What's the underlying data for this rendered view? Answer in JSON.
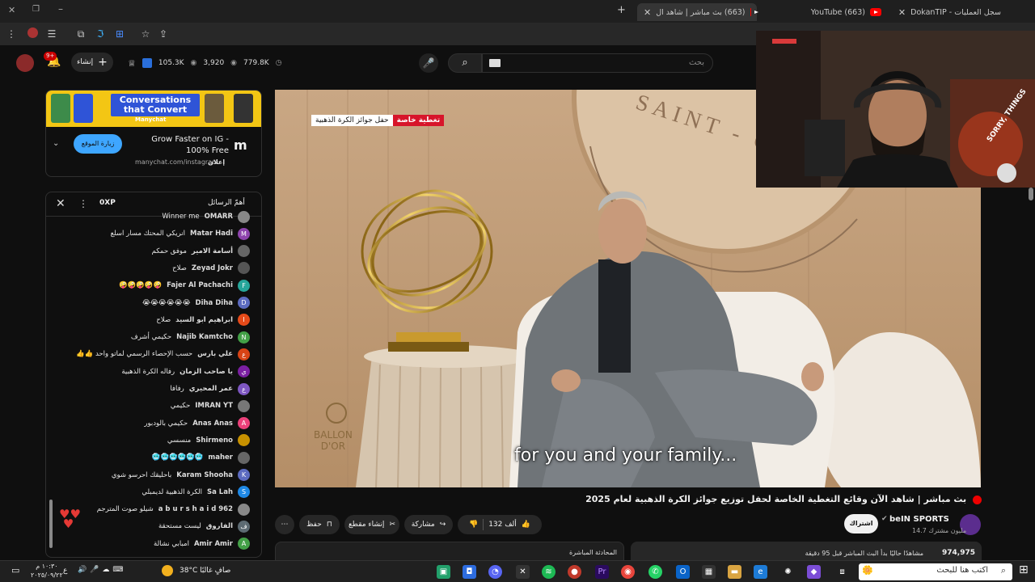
{
  "browser": {
    "tabs": [
      {
        "label": "سجل العمليات - DokanTIP",
        "active": false
      },
      {
        "label": "(663) YouTube",
        "active": false
      },
      {
        "label": "(663) بث مباشر | شاهد ال",
        "active": true
      }
    ],
    "new_tab": "+"
  },
  "youtube": {
    "search_placeholder": "بحث",
    "create_label": "إنشاء",
    "notifications_badge": "9+",
    "stats": {
      "views": "105.3K",
      "likes": "3,920",
      "subs": "779.8K"
    }
  },
  "ad": {
    "banner_title": "Conversations that Convert",
    "banner_brand": "Manychat",
    "headline": "Grow Faster on IG - 100% Free",
    "url": "manychat.com/instagram",
    "ad_label": "إعلان",
    "cta": "زيارة الموقع"
  },
  "chat": {
    "header_title": "أهمّ الرسائل",
    "points": "0XP",
    "messages": [
      {
        "name": "OMARR",
        "msg": "Winner me",
        "color": "#888",
        "initial": ""
      },
      {
        "name": "Matar Hadi",
        "msg": "انريكي المحتك مسار اسلع",
        "color": "#8e44ad",
        "initial": "M"
      },
      {
        "name": "أسامة الامير",
        "msg": "موفق حمكم",
        "color": "#666",
        "initial": ""
      },
      {
        "name": "Zeyad Jokr",
        "msg": "صلاح",
        "color": "#555",
        "initial": ""
      },
      {
        "name": "Fajer Al Pachachi",
        "msg": "🤪🤪🤪🤪🤪",
        "color": "#26a69a",
        "initial": "F"
      },
      {
        "name": "Diha Diha",
        "msg": "😭😭😭😭😭😭",
        "color": "#5c6bc0",
        "initial": "D"
      },
      {
        "name": "ابراهيم ابو السيد",
        "msg": "صلاح",
        "color": "#e64a19",
        "initial": "I"
      },
      {
        "name": "Najib Kamtcho",
        "msg": "حكيمي أشرف",
        "color": "#43a047",
        "initial": "N"
      },
      {
        "name": "علي بارس",
        "msg": "حسب الإحصاء الرسمي لماتو واحد 👍👍",
        "color": "#d84315",
        "initial": "ع"
      },
      {
        "name": "يا صاحب الزمان",
        "msg": "رفاله الكرة الذهبية",
        "color": "#7b1fa2",
        "initial": "ي"
      },
      {
        "name": "عمر المحيري",
        "msg": "رفافا",
        "color": "#7e57c2",
        "initial": "ع"
      },
      {
        "name": "IMRAN YT",
        "msg": "حكيمي",
        "color": "#777",
        "initial": ""
      },
      {
        "name": "Anas Anas",
        "msg": "حكيمي بالودبور",
        "color": "#ec407a",
        "initial": "A"
      },
      {
        "name": "Shirmeno",
        "msg": "منسسي",
        "color": "#c79100",
        "initial": ""
      },
      {
        "name": "maher",
        "msg": "🥶🥶🥶🥶🥶🥶",
        "color": "#666",
        "initial": ""
      },
      {
        "name": "Karam Shooha",
        "msg": "باحليقك احرسو شوي",
        "color": "#5c6bc0",
        "initial": "K"
      },
      {
        "name": "Sa Lah",
        "msg": "الكرة الذهبية لديمبلي",
        "color": "#1e88e5",
        "initial": "S"
      },
      {
        "name": "a b u r s h a i d 962",
        "msg": "شيلو صوت المترجم",
        "color": "#888",
        "initial": ""
      },
      {
        "name": "الفاروق",
        "msg": "ليست مستحقة",
        "color": "#5d6b73",
        "initial": "ف"
      },
      {
        "name": "Amir Amir",
        "msg": "امبابي نشالة",
        "color": "#43a047",
        "initial": "A"
      }
    ]
  },
  "video": {
    "badge_red": "تغطية خاصة",
    "badge_white": "حفل جوائز الكرة الذهبية",
    "logo_line1": "BALLON",
    "logo_line2": "D'OR",
    "wall_text": "SAINT - GE",
    "subtitle": "for you and your family..."
  },
  "pip": {
    "text": "SORRY, THINGS"
  },
  "below": {
    "title": "بث مباشر | شاهد الآن وقائع التغطية الخاصة لحفل توزيع جوائز الكرة الذهبية لعام 2025",
    "channel": "beIN SPORTS",
    "subs": "14.7 مليون مشترك",
    "subscribe": "اشتراك",
    "likes": "132 ألف",
    "share": "مشاركة",
    "clip": "إنشاء مقطع",
    "save": "حفظ",
    "views_text": "974,975",
    "views_sub": "مشاهدًا حاليًا  بدأ البث المباشر قبل 95 دقيقة",
    "live_chat": "المحادثة المباشرة"
  },
  "taskbar": {
    "search_placeholder": "اكتب هنا للبحث",
    "weather": "38°C  صافٍ غالبًا",
    "time": "١٠:٣٠ م",
    "date": "٢٠٢٥/٠٩/٢٢",
    "lang": "ع"
  },
  "colors": {
    "red": "#ff0000",
    "bg": "#0f0f0f",
    "panel": "#272727",
    "accent": "#3ea6ff"
  }
}
